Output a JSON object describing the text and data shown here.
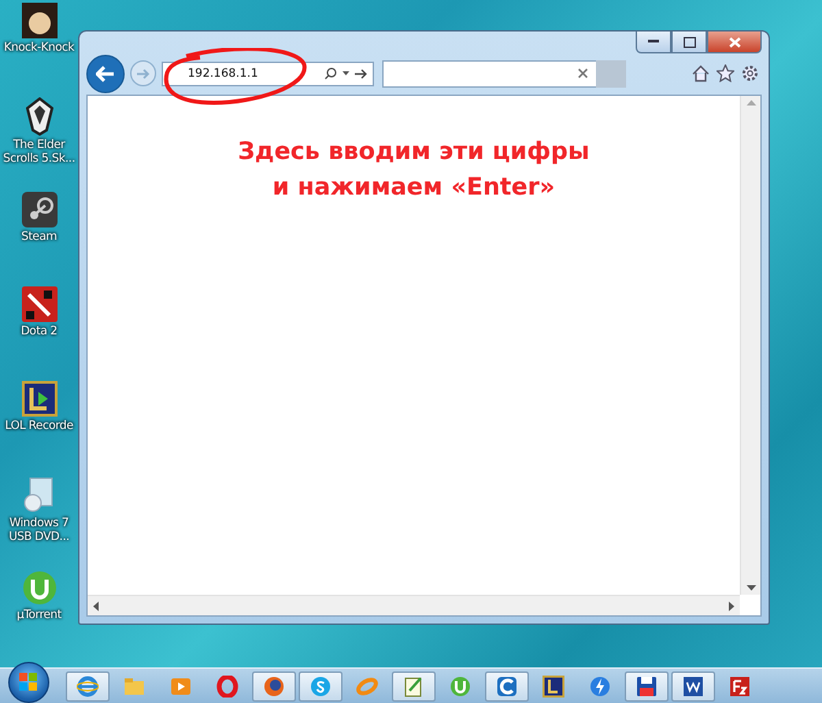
{
  "desktop_icons": [
    {
      "kind": "avatar",
      "label": "Knock-Knock"
    },
    {
      "kind": "skyrim",
      "label": "The Elder Scrolls 5.Sk..."
    },
    {
      "kind": "steam",
      "label": "Steam"
    },
    {
      "kind": "dota",
      "label": "Dota 2"
    },
    {
      "kind": "lol",
      "label": "LOL Recorde"
    },
    {
      "kind": "usb",
      "label": "Windows 7 USB DVD..."
    },
    {
      "kind": "utorrent",
      "label": "µTorrent"
    }
  ],
  "browser": {
    "address": "192.168.1.1",
    "annotation": [
      "Здесь вводим эти цифры",
      "и нажимаем «Enter»"
    ]
  },
  "taskbar": [
    {
      "kind": "ie",
      "open": true
    },
    {
      "kind": "folder",
      "open": false
    },
    {
      "kind": "player",
      "open": false
    },
    {
      "kind": "opera",
      "open": false
    },
    {
      "kind": "firefox",
      "open": true
    },
    {
      "kind": "skype",
      "open": true
    },
    {
      "kind": "orange",
      "open": false
    },
    {
      "kind": "notepad",
      "open": true
    },
    {
      "kind": "utorrent",
      "open": false
    },
    {
      "kind": "ccleaner",
      "open": true
    },
    {
      "kind": "lol",
      "open": false
    },
    {
      "kind": "bolt",
      "open": false
    },
    {
      "kind": "floppy",
      "open": true
    },
    {
      "kind": "word",
      "open": true
    },
    {
      "kind": "filezilla",
      "open": false
    }
  ]
}
